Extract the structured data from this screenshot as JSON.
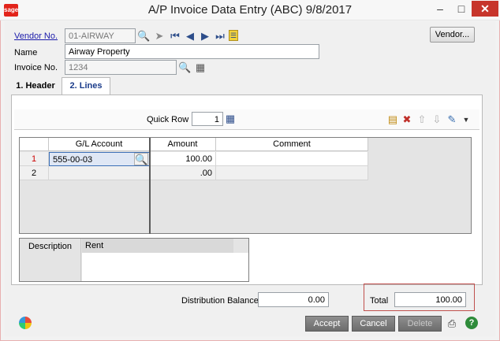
{
  "window": {
    "title": "A/P Invoice Data Entry (ABC) 9/8/2017",
    "logo": "sage",
    "controls": {
      "minimize": "–",
      "maximize": "□",
      "close": "✕"
    }
  },
  "header": {
    "vendor_no_label": "Vendor No.",
    "vendor_no_value": "01-AIRWAY",
    "name_label": "Name",
    "name_value": "Airway Property",
    "invoice_no_label": "Invoice No.",
    "invoice_no_value": "1234",
    "vendor_button": "Vendor..."
  },
  "tabs": [
    {
      "label": "1. Header",
      "active": false
    },
    {
      "label": "2. Lines",
      "active": true
    }
  ],
  "quick_row": {
    "label": "Quick Row",
    "value": "1"
  },
  "lines_grid": {
    "columns": [
      "G/L Account",
      "Amount",
      "Comment"
    ],
    "rows": [
      {
        "num": "1",
        "gl_account": "555-00-03",
        "amount": "100.00",
        "comment": ""
      },
      {
        "num": "2",
        "gl_account": "",
        "amount": ".00",
        "comment": ""
      }
    ]
  },
  "description": {
    "label": "Description",
    "value": "Rent"
  },
  "distribution_balance": {
    "label": "Distribution Balance",
    "value": "0.00"
  },
  "total": {
    "label": "Total",
    "value": "100.00"
  },
  "footer_buttons": {
    "accept": "Accept",
    "cancel": "Cancel",
    "delete": "Delete"
  },
  "colors": {
    "accent": "#c0504d",
    "link": "#1a1aaa",
    "dark_button": "#7a7a7a",
    "active_row_number": "#cc0000"
  }
}
